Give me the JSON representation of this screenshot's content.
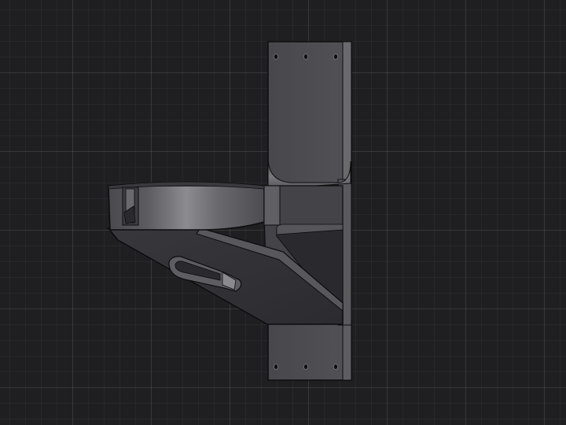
{
  "viewport": {
    "background_color": "#1f1f21",
    "grid_color": "#2e2e31"
  },
  "model": {
    "icon": "cad-bracket-model",
    "body_color": "#4a4a4e",
    "highlight_color": "#8a8a8e",
    "edge_color": "#0c0c0e",
    "hole_count": 6
  }
}
